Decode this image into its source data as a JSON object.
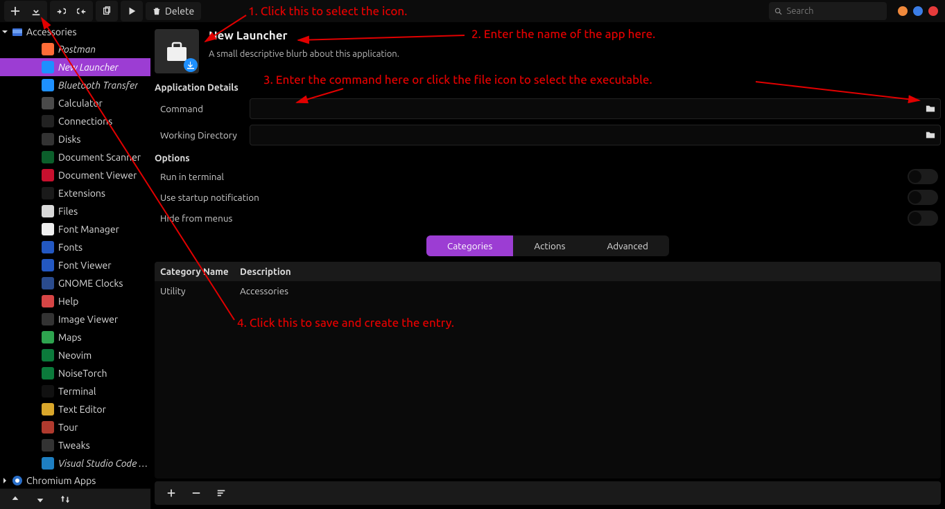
{
  "toolbar": {
    "delete_label": "Delete",
    "search_placeholder": "Search"
  },
  "sidebar": {
    "categories": [
      {
        "label": "Accessories",
        "expanded": true
      },
      {
        "label": "Chromium Apps",
        "expanded": false
      }
    ],
    "items": [
      {
        "label": "Postman",
        "color": "#ff6c37",
        "italic": true
      },
      {
        "label": "New Launcher",
        "color": "#1e90ff",
        "italic": true,
        "selected": true
      },
      {
        "label": "Bluetooth Transfer",
        "color": "#1e90ff",
        "italic": true
      },
      {
        "label": "Calculator",
        "color": "#4a4a4a"
      },
      {
        "label": "Connections",
        "color": "#222"
      },
      {
        "label": "Disks",
        "color": "#333"
      },
      {
        "label": "Document Scanner",
        "color": "#0b5f2b"
      },
      {
        "label": "Document Viewer",
        "color": "#c8102e"
      },
      {
        "label": "Extensions",
        "color": "#1a1a1a"
      },
      {
        "label": "Files",
        "color": "#d9d9d9"
      },
      {
        "label": "Font Manager",
        "color": "#efefef"
      },
      {
        "label": "Fonts",
        "color": "#2358c2"
      },
      {
        "label": "Font Viewer",
        "color": "#2358c2"
      },
      {
        "label": "GNOME Clocks",
        "color": "#2a4b8d"
      },
      {
        "label": "Help",
        "color": "#d64545"
      },
      {
        "label": "Image Viewer",
        "color": "#333"
      },
      {
        "label": "Maps",
        "color": "#2ea44f"
      },
      {
        "label": "Neovim",
        "color": "#0b7a3b"
      },
      {
        "label": "NoiseTorch",
        "color": "#0b7a3b"
      },
      {
        "label": "Terminal",
        "color": "#111"
      },
      {
        "label": "Text Editor",
        "color": "#d9a72b"
      },
      {
        "label": "Tour",
        "color": "#b03a2e"
      },
      {
        "label": "Tweaks",
        "color": "#333"
      },
      {
        "label": "Visual Studio Code …",
        "color": "#1e7fc2",
        "italic": true
      }
    ]
  },
  "launcher": {
    "title": "New Launcher",
    "description": "A small descriptive blurb about this application.",
    "details_heading": "Application Details",
    "command_label": "Command",
    "command_value": "",
    "workdir_label": "Working Directory",
    "workdir_value": "",
    "options_heading": "Options",
    "opt_terminal": "Run in terminal",
    "opt_startup": "Use startup notification",
    "opt_hide": "Hide from menus",
    "tabs": {
      "categories": "Categories",
      "actions": "Actions",
      "advanced": "Advanced"
    },
    "table": {
      "head_category": "Category Name",
      "head_desc": "Description",
      "rows": [
        {
          "name": "Utility",
          "desc": "Accessories"
        }
      ]
    }
  },
  "annotations": {
    "n1": "1. Click this to select the icon.",
    "n2": "2. Enter the name of the app here.",
    "n3": "3. Enter the command here or click the file icon to select the executable.",
    "n4": "4. Click this to save and create the entry."
  }
}
